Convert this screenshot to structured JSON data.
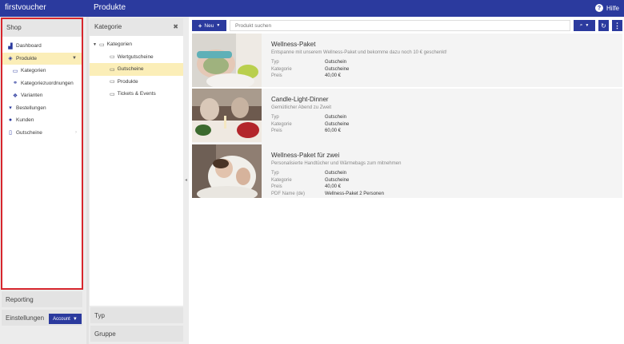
{
  "app": {
    "name": "firstvoucher",
    "page_title": "Produkte",
    "help_label": "Hilfe"
  },
  "sidebar": {
    "shop_title": "Shop",
    "items": [
      {
        "label": "Dashboard",
        "icon": "dashboard-icon"
      },
      {
        "label": "Produkte",
        "icon": "tags-icon"
      },
      {
        "label": "Kategorien",
        "icon": "folder-icon"
      },
      {
        "label": "Kategoriezuordnungen",
        "icon": "link-icon"
      },
      {
        "label": "Varianten",
        "icon": "cubes-icon"
      },
      {
        "label": "Bestellungen",
        "icon": "cart-icon"
      },
      {
        "label": "Kunden",
        "icon": "user-icon"
      },
      {
        "label": "Gutscheine",
        "icon": "file-icon"
      }
    ],
    "reporting": "Reporting",
    "einstellungen": "Einstellungen",
    "account_label": "Account"
  },
  "filter": {
    "kategorie_title": "Kategorie",
    "tree": [
      {
        "label": "Kategorien"
      },
      {
        "label": "Wertgutscheine"
      },
      {
        "label": "Gutscheine"
      },
      {
        "label": "Produkte"
      },
      {
        "label": "Tickets & Events"
      }
    ],
    "typ_title": "Typ",
    "gruppe_title": "Gruppe"
  },
  "toolbar": {
    "new_label": "Neu",
    "search_placeholder": "Produkt suchen"
  },
  "products": [
    {
      "name": "Wellness-Paket",
      "description": "Entspanne mit unserem Wellness-Paket und bekomme dazu noch 10 € geschenkt!",
      "rows": [
        {
          "key": "Typ",
          "value": "Gutschein"
        },
        {
          "key": "Kategorie",
          "value": "Gutscheine"
        },
        {
          "key": "Preis",
          "value": "40,00 €"
        }
      ]
    },
    {
      "name": "Candle-Light-Dinner",
      "description": "Gemütlicher Abend zu Zweit",
      "rows": [
        {
          "key": "Typ",
          "value": "Gutschein"
        },
        {
          "key": "Kategorie",
          "value": "Gutscheine"
        },
        {
          "key": "Preis",
          "value": "60,00 €"
        }
      ]
    },
    {
      "name": "Wellness-Paket für zwei",
      "description": "Personalisierte Handtücher und Wärmebags zum mitnehmen",
      "rows": [
        {
          "key": "Typ",
          "value": "Gutschein"
        },
        {
          "key": "Kategorie",
          "value": "Gutscheine"
        },
        {
          "key": "Preis",
          "value": "40,00 €"
        },
        {
          "key": "PDF Name (de)",
          "value": "Wellness-Paket 2 Personen"
        }
      ]
    }
  ],
  "colors": {
    "brand": "#2b3a9e",
    "active_row": "#fbeeb8",
    "highlight_border": "#d7262d"
  }
}
